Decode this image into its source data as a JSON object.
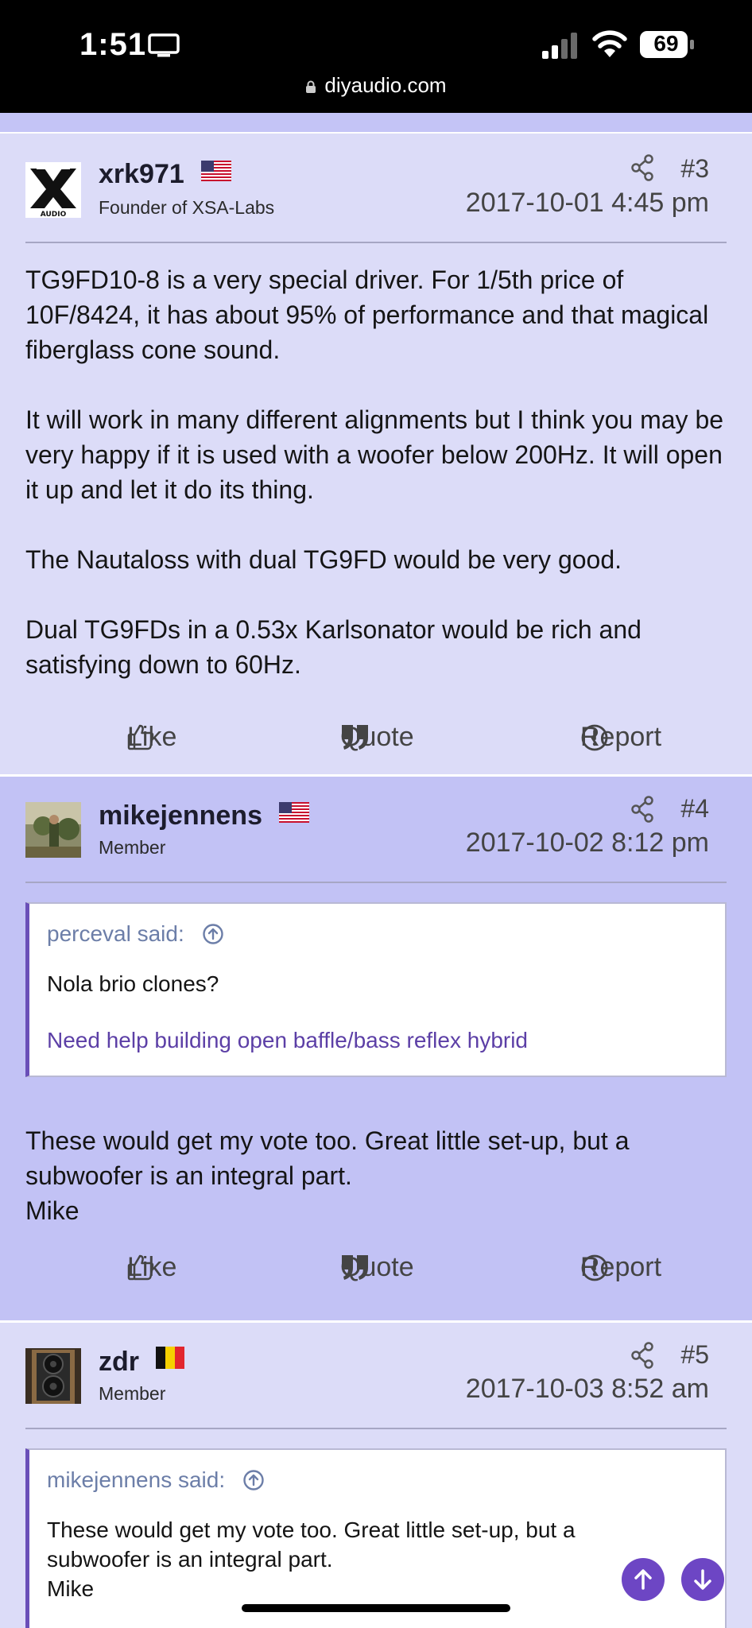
{
  "status_bar": {
    "time": "1:51",
    "battery": "69",
    "url": "diyaudio.com"
  },
  "posts": [
    {
      "username": "xrk971",
      "flag": "us-flag",
      "role": "Founder of XSA-Labs",
      "number": "#3",
      "date": "2017-10-01 4:45 pm",
      "body": [
        "TG9FD10-8 is a very special driver. For 1/5th price of 10F/8424, it has about 95% of performance and that magical fiberglass cone sound.",
        "It will work in many different alignments but I think you may be very happy if it is used with a woofer below 200Hz. It will open it up and let it do its thing.",
        "The Nautaloss with dual TG9FD would be very good.",
        "Dual TG9FDs in a 0.53x Karlsonator would be rich and satisfying down to 60Hz."
      ],
      "actions": {
        "like": "Like",
        "quote": "Quote",
        "report": "Report"
      }
    },
    {
      "username": "mikejennens",
      "flag": "us-flag",
      "role": "Member",
      "number": "#4",
      "date": "2017-10-02 8:12 pm",
      "quote": {
        "author": "perceval said:",
        "text": "Nola brio clones?",
        "link": "Need help building open baffle/bass reflex hybrid"
      },
      "body": [
        "These would get my vote too. Great little set-up, but a subwoofer is an integral part.",
        "Mike"
      ],
      "actions": {
        "like": "Like",
        "quote": "Quote",
        "report": "Report"
      }
    },
    {
      "username": "zdr",
      "flag": "belgium-flag",
      "role": "Member",
      "number": "#5",
      "date": "2017-10-03 8:52 am",
      "quote": {
        "author": "mikejennens said:",
        "text": "These would get my vote too. Great little set-up, but a subwoofer is an integral part.",
        "text2": "Mike"
      }
    }
  ],
  "colors": {
    "post_light": "#dcdcf8",
    "post_dark": "#c2c2f5",
    "accent": "#6d46c4",
    "link": "#5c3fa6"
  }
}
